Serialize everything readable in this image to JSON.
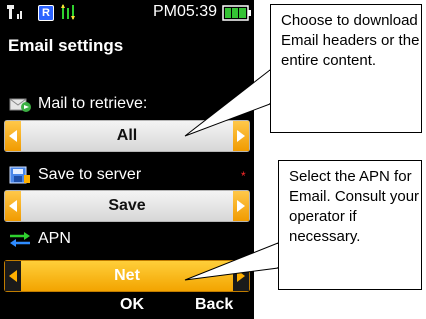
{
  "status_bar": {
    "signal_icon": "signal-bars-icon",
    "roaming_badge": "R",
    "data_icon": "data-activity-icon",
    "time": "PM05:39",
    "battery_icon": "battery-icon"
  },
  "screen": {
    "title": "Email settings",
    "settings": [
      {
        "icon": "mail-retrieve-icon",
        "label": "Mail to retrieve:",
        "value": "All",
        "required": true,
        "selected": false
      },
      {
        "icon": "save-server-icon",
        "label": "Save to server",
        "value": "Save",
        "required": true,
        "selected": false
      },
      {
        "icon": "apn-arrows-icon",
        "label": "APN",
        "value": "Net",
        "required": false,
        "selected": true
      }
    ],
    "softkeys": {
      "left": "OK",
      "right": "Back"
    }
  },
  "callouts": [
    {
      "text": "Choose to download Email headers or the entire content.",
      "points_to": "Mail to retrieve:"
    },
    {
      "text": "Select the APN for Email. Consult your operator if necessary.",
      "points_to": "APN"
    }
  ],
  "colors": {
    "screen_bg": "#000000",
    "accent_orange": "#f3a400",
    "required_marker": "#ff2a2a",
    "text_white": "#ffffff"
  }
}
